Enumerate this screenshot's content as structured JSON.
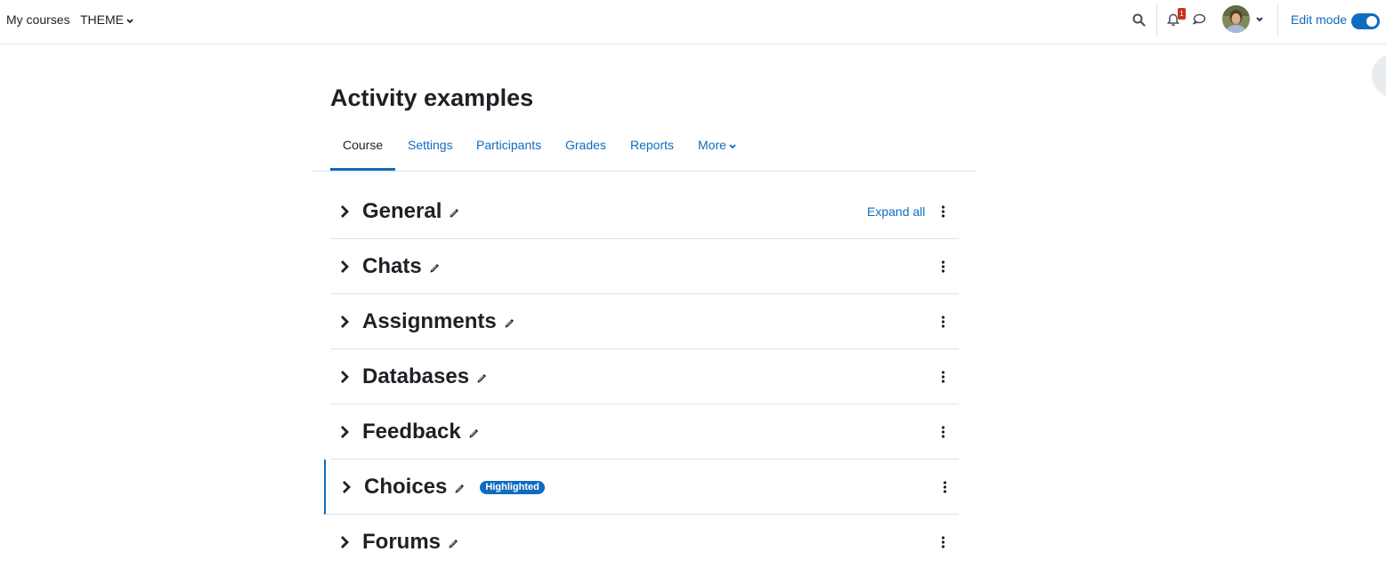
{
  "navbar": {
    "my_courses": "My courses",
    "theme": "THEME",
    "notification_count": "1",
    "edit_mode_label": "Edit mode",
    "edit_mode_on": true
  },
  "page": {
    "title": "Activity examples"
  },
  "tabs": [
    {
      "label": "Course",
      "active": true
    },
    {
      "label": "Settings",
      "active": false
    },
    {
      "label": "Participants",
      "active": false
    },
    {
      "label": "Grades",
      "active": false
    },
    {
      "label": "Reports",
      "active": false
    },
    {
      "label": "More",
      "active": false
    }
  ],
  "course": {
    "expand_all": "Expand all",
    "sections": [
      {
        "title": "General",
        "highlighted": false
      },
      {
        "title": "Chats",
        "highlighted": false
      },
      {
        "title": "Assignments",
        "highlighted": false
      },
      {
        "title": "Databases",
        "highlighted": false
      },
      {
        "title": "Feedback",
        "highlighted": false
      },
      {
        "title": "Choices",
        "highlighted": true,
        "badge": "Highlighted"
      },
      {
        "title": "Forums",
        "highlighted": false
      }
    ]
  },
  "colors": {
    "accent": "#0f6cbf",
    "text": "#1d2125",
    "border": "#dee2e6",
    "notification": "#ca3120"
  },
  "icons": [
    "search-icon",
    "bell-icon",
    "message-icon",
    "chevron-down-icon",
    "chevron-right-icon",
    "pencil-icon",
    "kebab-menu-icon"
  ]
}
